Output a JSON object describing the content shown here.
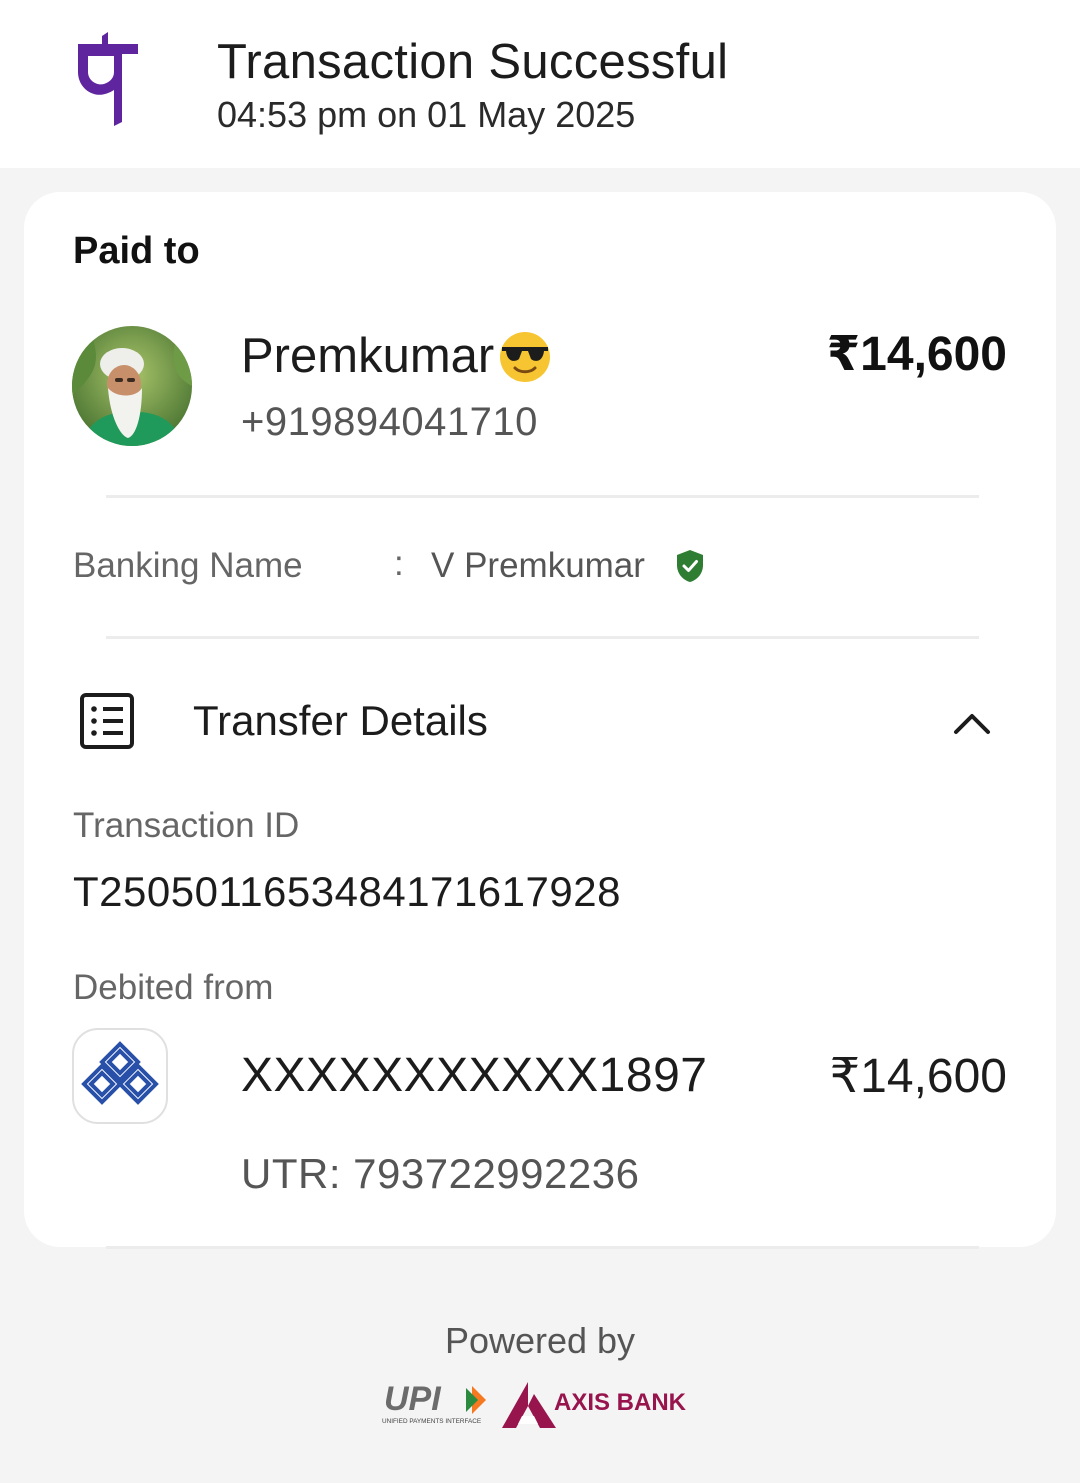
{
  "header": {
    "title": "Transaction Successful",
    "timestamp": "04:53 pm on 01 May 2025",
    "brand_color": "#5f259f"
  },
  "paid_to": {
    "section_label": "Paid to",
    "payee_name": "Premkumar",
    "payee_emoji": "smiling-face-with-sunglasses",
    "phone": "+919894041710",
    "amount": "₹14,600"
  },
  "banking": {
    "label": "Banking Name",
    "separator": ":",
    "value": "V Premkumar",
    "verified_color": "#2e7d32"
  },
  "transfer_details": {
    "title": "Transfer Details",
    "expanded": true,
    "transaction_id_label": "Transaction ID",
    "transaction_id": "T2505011653484171617928",
    "debited_from_label": "Debited from",
    "account_number": "XXXXXXXXXXX1897",
    "debited_amount": "₹14,600",
    "utr": "UTR: 793722992236"
  },
  "footer": {
    "powered_by": "Powered by",
    "upi_text": "UPI",
    "upi_subtext": "UNIFIED PAYMENTS INTERFACE",
    "bank_text": "AXIS BANK",
    "bank_color": "#97144d"
  }
}
